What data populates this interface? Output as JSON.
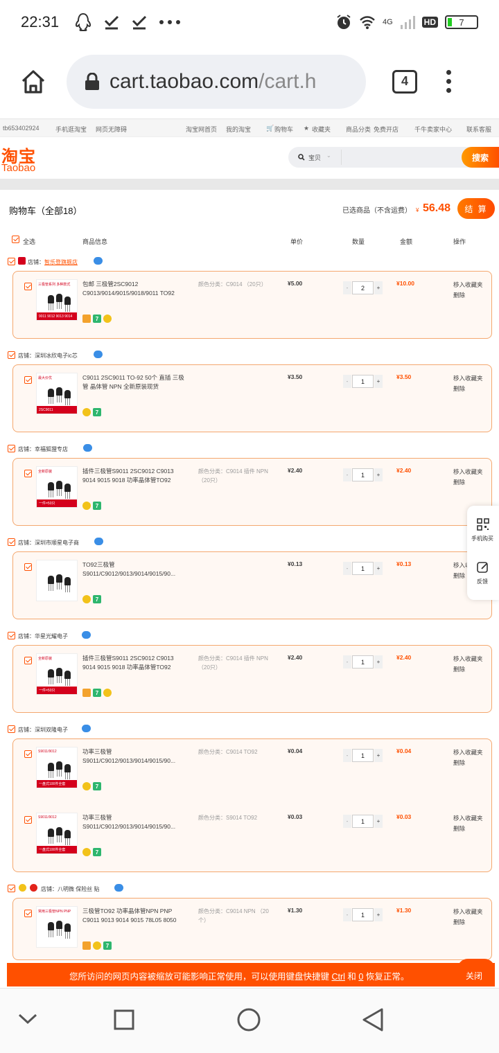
{
  "status_bar": {
    "time": "22:31",
    "network": "4G",
    "hd": "HD",
    "battery": "7"
  },
  "browser": {
    "url_host": "cart.taobao.com",
    "url_path": "/cart.h",
    "tab_count": "4"
  },
  "site_nav": {
    "user": "tb653402924",
    "mobile": "手机逛淘宝",
    "accessible": "网页无障碍",
    "home": "淘宝网首页",
    "my_taobao": "我的淘宝",
    "cart": "购物车",
    "favorites": "收藏夹",
    "categories": "商品分类",
    "open_shop": "免费开店",
    "seller_center": "千牛卖家中心",
    "service": "联系客服"
  },
  "header": {
    "logo_cn": "淘宝",
    "logo_en": "Taobao",
    "search_scope": "宝贝",
    "search_button": "搜索"
  },
  "cart": {
    "title": "购物车（全部18）",
    "selected_label": "已选商品（不含运费）",
    "yen": "¥",
    "total": "56.48",
    "checkout": "结 算",
    "columns": {
      "select_all": "全选",
      "info": "商品信息",
      "unit_price": "单价",
      "quantity": "数量",
      "amount": "金额",
      "operation": "操作"
    },
    "shop_prefix": "店铺：",
    "move_fav": "移入收藏夹",
    "delete": "删除",
    "shops": [
      {
        "name": "智乐登旗舰店",
        "items": [
          {
            "title": "包邮 三极管2SC9012 C9013/9014/9015/9018/9011 TO92",
            "sku": "颜色分类：C9014 （20只）",
            "price": "¥5.00",
            "qty": "2",
            "amount": "¥10.00",
            "thumb_text": "三极管系列 多种款式",
            "thumb_band": "9011 9012 9013 9014"
          }
        ]
      },
      {
        "name": "深圳冰欣电子ic芯",
        "items": [
          {
            "title": "C9011 2SC9011 TO-92 50个 直插 三极管 晶体管 NPN 全新原装现货",
            "sku": "",
            "price": "¥3.50",
            "qty": "1",
            "amount": "¥3.50",
            "thumb_text": "最大价优",
            "thumb_band": "2SC9011"
          }
        ]
      },
      {
        "name": "幸福狐狸专店",
        "items": [
          {
            "title": "插件三极管S9011 2SC9012 C9013 9014 9015 9018 功率晶体管TO92",
            "sku": "颜色分类：C9014 插件 NPN （20只）",
            "price": "¥2.40",
            "qty": "1",
            "amount": "¥2.40",
            "thumb_text": "全新原装",
            "thumb_band": "一件=50只"
          }
        ]
      },
      {
        "name": "深圳市顺星电子商",
        "items": [
          {
            "title": "TO92三极管 S9011/C9012/9013/9014/9015/90...",
            "sku": "",
            "price": "¥0.13",
            "qty": "1",
            "amount": "¥0.13",
            "thumb_text": "",
            "thumb_band": ""
          }
        ]
      },
      {
        "name": "华星光耀电子",
        "items": [
          {
            "title": "插件三极管S9011 2SC9012 C9013 9014 9015 9018 功率晶体管TO92",
            "sku": "颜色分类：C9014 插件 NPN （20只）",
            "price": "¥2.40",
            "qty": "1",
            "amount": "¥2.40",
            "thumb_text": "全新原装",
            "thumb_band": "一件=50只"
          }
        ]
      },
      {
        "name": "深圳双隆电子",
        "items": [
          {
            "title": "功率三极管 S9011/C9012/9013/9014/9015/90...",
            "sku": "颜色分类：C9014 TO92",
            "price": "¥0.04",
            "qty": "1",
            "amount": "¥0.04",
            "thumb_text": "S9011/9012",
            "thumb_band": "一盘式100件全套"
          },
          {
            "title": "功率三极管 S9011/C9012/9013/9014/9015/90...",
            "sku": "颜色分类：S9014 TO92",
            "price": "¥0.03",
            "qty": "1",
            "amount": "¥0.03",
            "thumb_text": "S9011/9012",
            "thumb_band": "一盘式100件全套"
          }
        ]
      },
      {
        "name": "八明微 保险丝 贴",
        "items": [
          {
            "title": "三极管TO92 功率晶体管NPN PNP C9011 9013 9014 9015 78L05 8050",
            "sku": "颜色分类：C9014 NPN （20个）",
            "price": "¥1.30",
            "qty": "1",
            "amount": "¥1.30",
            "thumb_text": "常用三极管NPN PNP",
            "thumb_band": ""
          }
        ]
      }
    ]
  },
  "side_float": {
    "mobile_buy": "手机购买",
    "feedback": "反馈"
  },
  "notice": {
    "text_1": "您所访问的网页内容被缩放可能影响正常使用，可以使用键盘快捷键 ",
    "ctrl": "Ctrl",
    "and": " 和 ",
    "zero": "0",
    "text_2": " 恢复正常。",
    "close": "关闭"
  },
  "colors": {
    "brand": "#ff5000",
    "border": "#f4a76e",
    "item_bg": "#fff8f3"
  }
}
